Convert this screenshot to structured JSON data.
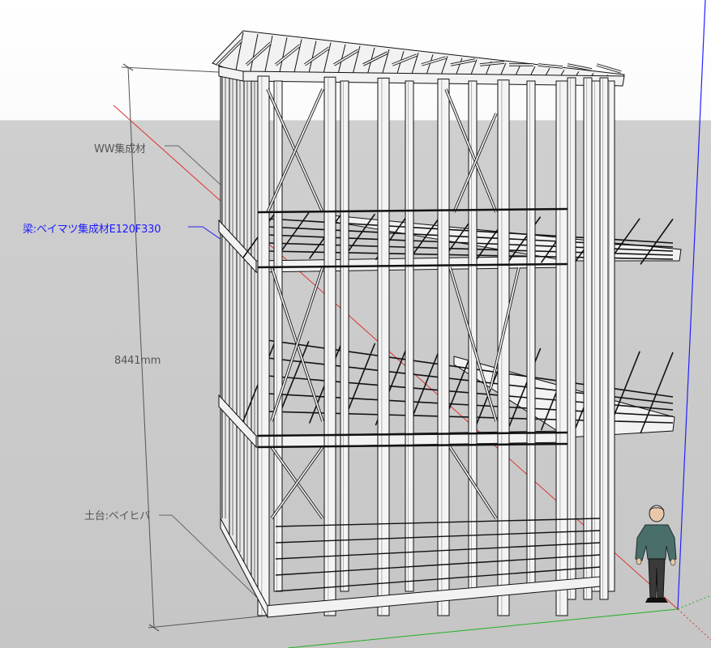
{
  "view": {
    "background": {
      "sky": "#fbfbfb",
      "ground": "#c9c9c9"
    },
    "axes": {
      "red": "#e03030",
      "green": "#20b020",
      "blue": "#2020ff"
    }
  },
  "annotations": {
    "ww_label": "WW集成材",
    "beam_label": "梁:ベイマツ集成材E120F330",
    "dimension_label": "8441mm",
    "sill_label": "土台:ベイヒバ"
  }
}
